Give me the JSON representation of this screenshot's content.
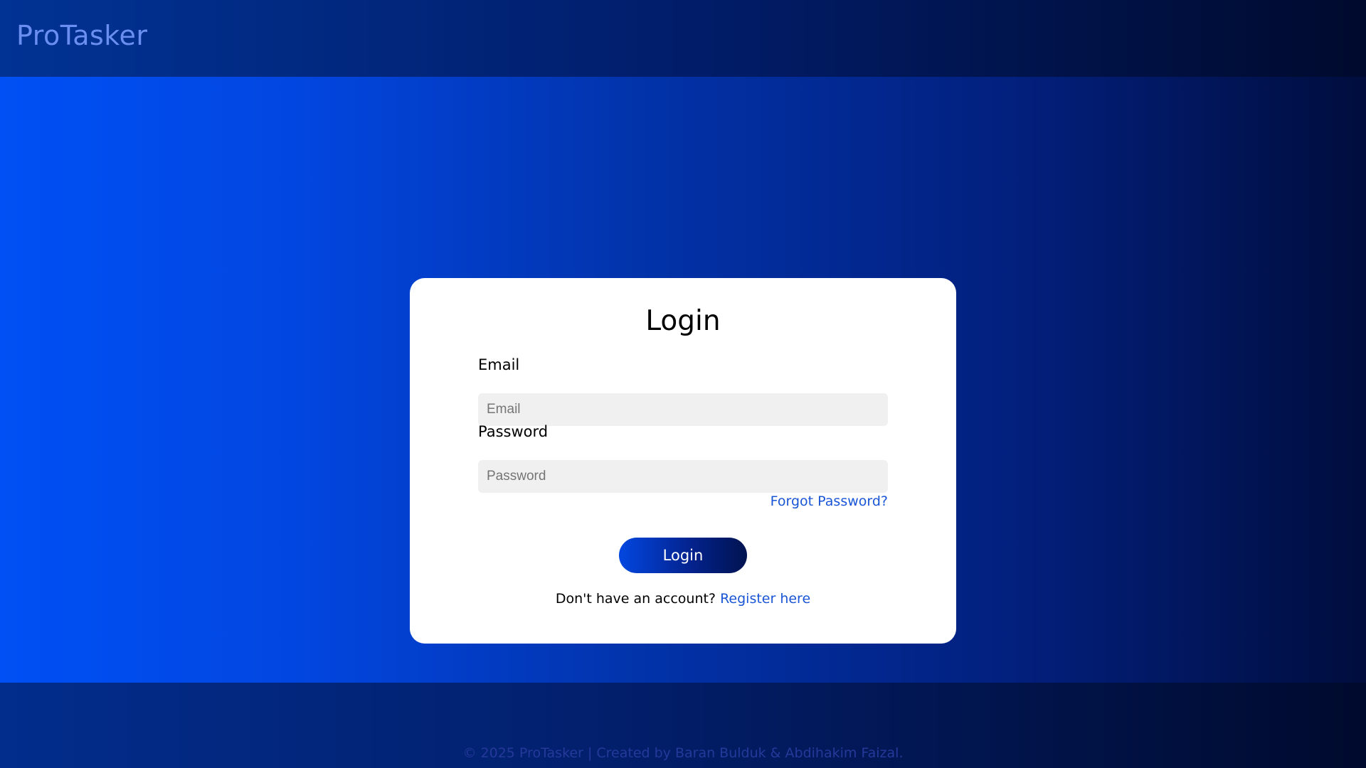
{
  "header": {
    "brand": "ProTasker"
  },
  "login_card": {
    "title": "Login",
    "email": {
      "label": "Email",
      "placeholder": "Email",
      "value": ""
    },
    "password": {
      "label": "Password",
      "placeholder": "Password",
      "value": ""
    },
    "forgot_link": "Forgot Password?",
    "submit_label": "Login",
    "register_prompt": "Don't have an account?",
    "register_link": "Register here"
  },
  "footer": {
    "text": "© 2025 ProTasker | Created by Baran Bulduk & Abdihakim Faizal."
  },
  "colors": {
    "accent": "#0050f5",
    "link": "#1a55d6",
    "brand_text": "#6a8ff0",
    "input_bg": "#f0f0f0",
    "dark_navy": "#000a2e"
  }
}
